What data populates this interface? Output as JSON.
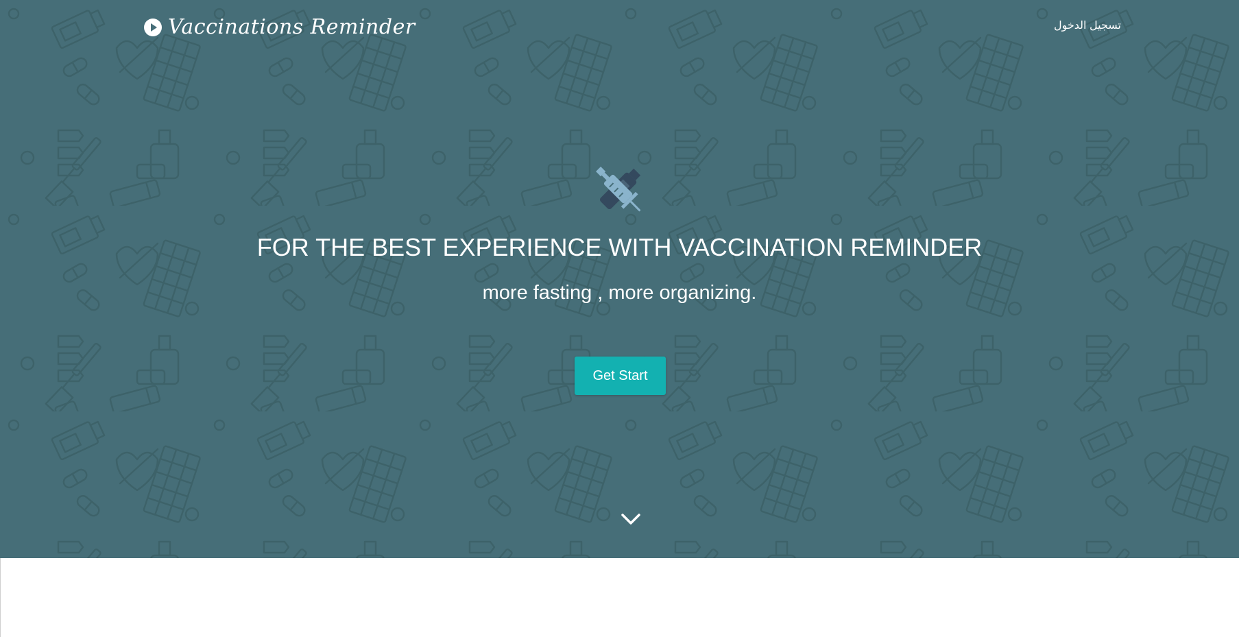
{
  "navbar": {
    "brand_label": "Vaccinations Reminder",
    "brand_icon": "play-circle-icon",
    "login_label": "تسجيل الدخول"
  },
  "hero": {
    "logo_icon": "syringe-vaccine-icon",
    "headline": "FOR THE BEST EXPERIENCE WITH VACCINATION REMINDER",
    "subheadline": "more fasting , more organizing.",
    "cta_label": "Get Start",
    "scroll_icon": "chevron-down-icon",
    "background_pattern": "medical-icons-pattern"
  },
  "colors": {
    "hero_background": "#466e78",
    "cta_background": "#13b1b1",
    "text": "#ffffff",
    "logo_light": "#8ab4cc",
    "logo_dark": "#34495e"
  }
}
